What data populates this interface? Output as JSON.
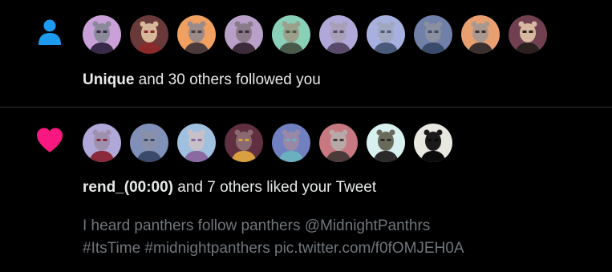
{
  "colors": {
    "background": "#000000",
    "divider": "#2f3336",
    "primary_text": "#e7e9ea",
    "secondary_text": "#71767b",
    "follow_icon": "#1d9bf0",
    "like_icon": "#f91880"
  },
  "notifications": [
    {
      "type": "follow",
      "icon": "person-icon",
      "avatars": [
        {
          "bg": "#c9a0d8",
          "face": "#8a8a9a",
          "accent": "#3a2a4a"
        },
        {
          "bg": "#6a3a3a",
          "face": "#d8b89a",
          "accent": "#8a2a2a"
        },
        {
          "bg": "#f0a060",
          "face": "#9a8a8a",
          "accent": "#4a3a3a"
        },
        {
          "bg": "#b8a0c8",
          "face": "#8a7a8a",
          "accent": "#3a2a3a"
        },
        {
          "bg": "#8ad0b8",
          "face": "#9aa08a",
          "accent": "#4a5a4a"
        },
        {
          "bg": "#b0a8d8",
          "face": "#a8a0b8",
          "accent": "#5a4a6a"
        },
        {
          "bg": "#a8b0e0",
          "face": "#a0a8c0",
          "accent": "#4a5a7a"
        },
        {
          "bg": "#7080a8",
          "face": "#8a90a0",
          "accent": "#3a4a6a"
        },
        {
          "bg": "#e8a070",
          "face": "#a89890",
          "accent": "#3a3030"
        },
        {
          "bg": "#704050",
          "face": "#d8b8a0",
          "accent": "#2a2020"
        }
      ],
      "actor": "Unique",
      "text": "and 30 others followed you"
    },
    {
      "type": "like",
      "icon": "heart-icon",
      "avatars": [
        {
          "bg": "#b0a8d8",
          "face": "#a090b0",
          "accent": "#8a2a3a"
        },
        {
          "bg": "#8090b8",
          "face": "#8a90a8",
          "accent": "#3a4a6a"
        },
        {
          "bg": "#a0c0e0",
          "face": "#c8c0c8",
          "accent": "#8a6aa0"
        },
        {
          "bg": "#603040",
          "face": "#8a6a70",
          "accent": "#d8a040"
        },
        {
          "bg": "#7080c0",
          "face": "#9a88a8",
          "accent": "#6ab0c0"
        },
        {
          "bg": "#c87880",
          "face": "#b8a8a8",
          "accent": "#4a3a3a"
        },
        {
          "bg": "#d8f0f0",
          "face": "#6a6a5a",
          "accent": "#2a2a2a"
        },
        {
          "bg": "#e8e8e0",
          "face": "#1a1a1a",
          "accent": "#0a0a0a"
        }
      ],
      "actor": "rend_(00:00)",
      "text": "and 7 others liked your Tweet",
      "tweet_preview": {
        "line1": "I heard panthers follow panthers @MidnightPanthrs",
        "line2": "#ItsTime #midnightpanthers pic.twitter.com/f0fOMJEH0A"
      }
    }
  ]
}
